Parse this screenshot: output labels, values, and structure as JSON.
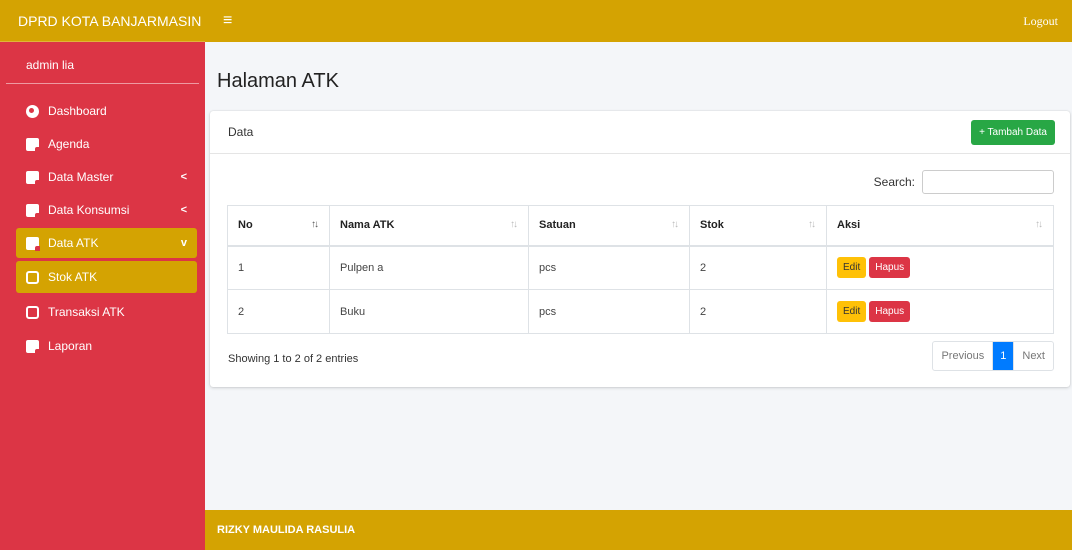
{
  "app": {
    "brand": "DPRD KOTA BANJARMASIN",
    "user": "admin lia"
  },
  "sidebar": {
    "items": [
      {
        "label": "Dashboard"
      },
      {
        "label": "Agenda"
      },
      {
        "label": "Data Master",
        "chevron": "<"
      },
      {
        "label": "Data Konsumsi",
        "chevron": "<"
      },
      {
        "label": "Data ATK",
        "chevron": "v"
      },
      {
        "label": "Stok ATK"
      },
      {
        "label": "Transaksi ATK"
      },
      {
        "label": "Laporan"
      }
    ]
  },
  "topbar": {
    "menu_icon": "≡",
    "logout": "Logout"
  },
  "page": {
    "title": "Halaman ATK"
  },
  "card": {
    "title": "Data",
    "add_button": "+ Tambah Data",
    "search_label": "Search:",
    "search_value": ""
  },
  "table": {
    "columns": [
      "No",
      "Nama ATK",
      "Satuan",
      "Stok",
      "Aksi"
    ],
    "rows": [
      {
        "no": "1",
        "nama": "Pulpen a",
        "satuan": "pcs",
        "stok": "2"
      },
      {
        "no": "2",
        "nama": "Buku",
        "satuan": "pcs",
        "stok": "2"
      }
    ],
    "edit_label": "Edit",
    "delete_label": "Hapus"
  },
  "info": "Showing 1 to 2 of 2 entries",
  "pagination": {
    "previous": "Previous",
    "current": "1",
    "next": "Next"
  },
  "footer": "RIZKY MAULIDA RASULIA",
  "colors": {
    "sidebar": "#dc3545",
    "accent": "#d4a302",
    "add": "#28a745",
    "edit": "#ffc107",
    "delete": "#dc3545",
    "page": "#007bff"
  }
}
